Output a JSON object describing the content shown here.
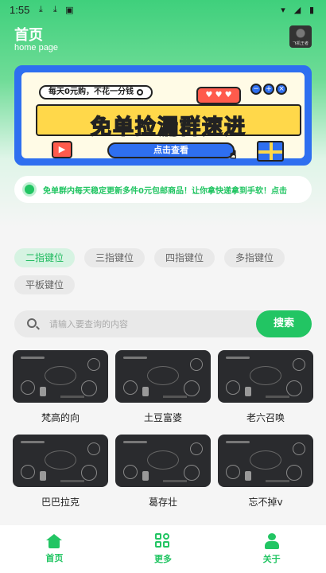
{
  "status_bar": {
    "time": "1:55"
  },
  "header": {
    "title": "首页",
    "subtitle": "home page",
    "avatar_caption": "飞机王者"
  },
  "banner": {
    "tag_text": "每天0元购，不花一分钱",
    "hearts": "♥ ♥ ♥",
    "headline": "免单捡漏群速进",
    "button_label": "点击查看"
  },
  "notice": {
    "text": "免单群内每天稳定更新多件0元包邮商品！让你拿快递拿到手软！点击"
  },
  "categories": [
    {
      "label": "二指键位",
      "active": true
    },
    {
      "label": "三指键位"
    },
    {
      "label": "四指键位"
    },
    {
      "label": "多指键位"
    },
    {
      "label": "平板键位"
    }
  ],
  "search": {
    "placeholder": "请输入要查询的内容",
    "button_label": "搜索"
  },
  "layouts": [
    {
      "title": "梵高的向"
    },
    {
      "title": "土豆富婆"
    },
    {
      "title": "老六召唤"
    },
    {
      "title": "巴巴拉克"
    },
    {
      "title": "葛存壮"
    },
    {
      "title": "忘不掉v"
    }
  ],
  "bottom_nav": [
    {
      "label": "首页",
      "icon": "home-icon"
    },
    {
      "label": "更多",
      "icon": "apps-icon"
    },
    {
      "label": "关于",
      "icon": "user-icon"
    }
  ],
  "colors": {
    "accent": "#22c563",
    "banner_blue": "#2e6ff0",
    "banner_yellow": "#ffd84a"
  }
}
